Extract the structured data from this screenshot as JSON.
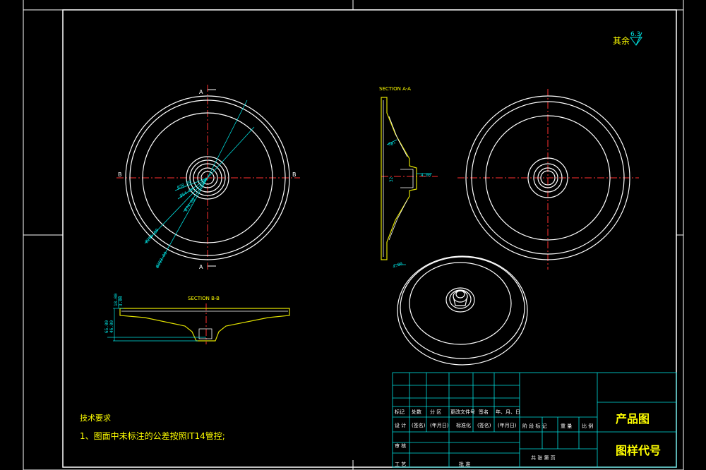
{
  "surface_finish": {
    "label": "其余",
    "value": "6.3"
  },
  "views": {
    "section_aa_label": "SECTION A-A",
    "section_bb_label": "SECTION B-B",
    "cut_letter_a": "A",
    "cut_letter_b": "B"
  },
  "dimensions_front": [
    "Ø38.00",
    "Ø54.00",
    "Ø74.00",
    "Ø256.00",
    "Ø283.00"
  ],
  "dimensions_section_aa": [
    "60°",
    "4.00",
    "32",
    "4.00"
  ],
  "dimensions_section_bb": [
    "3.00",
    "18.00",
    "46.00",
    "65.00"
  ],
  "notes": {
    "title": "技术要求",
    "line1": "1、图面中未标注的公差按照IT14管控;"
  },
  "title_block": {
    "headers": [
      "标记",
      "处数",
      "分 区",
      "更改文件号",
      "签名",
      "年、月、日"
    ],
    "row2": [
      "设 计",
      "(签名)",
      "(年月日)",
      "标准化",
      "(签名)",
      "(年月日)"
    ],
    "row3": [
      "审 核"
    ],
    "row4": [
      "工 艺",
      "批 准"
    ],
    "stage_headers": [
      "阶 段 标 记",
      "重 量",
      "比 例"
    ],
    "sheet_text": "共   张   第   页",
    "product_name": "产品图",
    "drawing_code": "图样代号"
  },
  "colors": {
    "frame": "#ffffff",
    "part_outline": "#ffffff",
    "center_line": "#ff3030",
    "dimension": "#00e0e0",
    "section_hatch": "#e0e000",
    "title_text": "#ffff00"
  }
}
